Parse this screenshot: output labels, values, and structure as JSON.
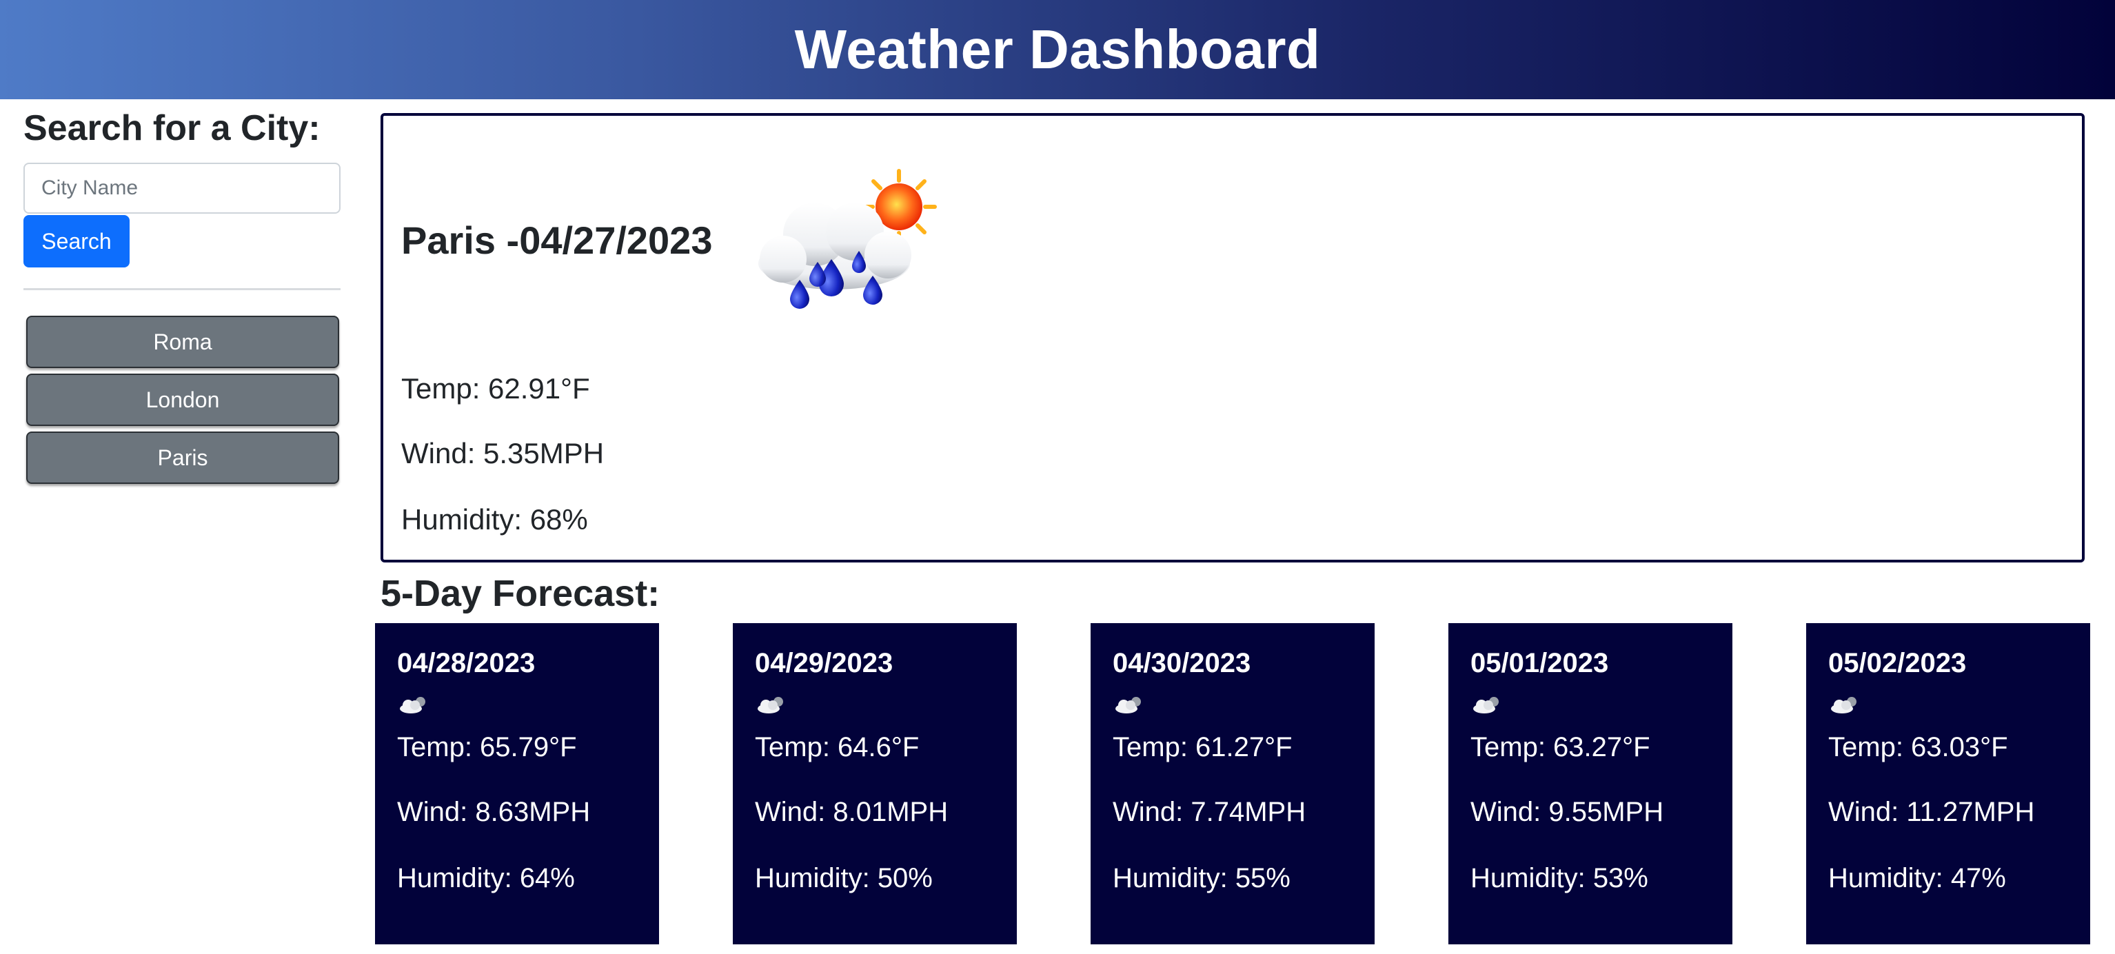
{
  "header": {
    "title": "Weather Dashboard"
  },
  "sidebar": {
    "heading": "Search for a City:",
    "input_placeholder": "City Name",
    "search_label": "Search",
    "history": [
      {
        "label": "Roma"
      },
      {
        "label": "London"
      },
      {
        "label": "Paris"
      }
    ]
  },
  "current": {
    "title": "Paris -04/27/2023",
    "icon": "rain-sun-icon",
    "temp": "Temp: 62.91°F",
    "wind": "Wind: 5.35MPH",
    "humidity": "Humidity: 68%"
  },
  "forecast": {
    "title": "5-Day Forecast:",
    "days": [
      {
        "date": "04/28/2023",
        "icon": "cloud-icon",
        "temp": "Temp: 65.79°F",
        "wind": "Wind: 8.63MPH",
        "humidity": "Humidity: 64%"
      },
      {
        "date": "04/29/2023",
        "icon": "cloud-icon",
        "temp": "Temp: 64.6°F",
        "wind": "Wind: 8.01MPH",
        "humidity": "Humidity: 50%"
      },
      {
        "date": "04/30/2023",
        "icon": "cloud-icon",
        "temp": "Temp: 61.27°F",
        "wind": "Wind: 7.74MPH",
        "humidity": "Humidity: 55%"
      },
      {
        "date": "05/01/2023",
        "icon": "cloud-icon",
        "temp": "Temp: 63.27°F",
        "wind": "Wind: 9.55MPH",
        "humidity": "Humidity: 53%"
      },
      {
        "date": "05/02/2023",
        "icon": "cloud-icon",
        "temp": "Temp: 63.03°F",
        "wind": "Wind: 11.27MPH",
        "humidity": "Humidity: 47%"
      }
    ]
  },
  "colors": {
    "header_gradient_start": "#4f7bc7",
    "header_gradient_end": "#02023a",
    "forecast_card_bg": "#02023a",
    "search_button": "#0d6efd",
    "history_button": "#6c757d"
  }
}
